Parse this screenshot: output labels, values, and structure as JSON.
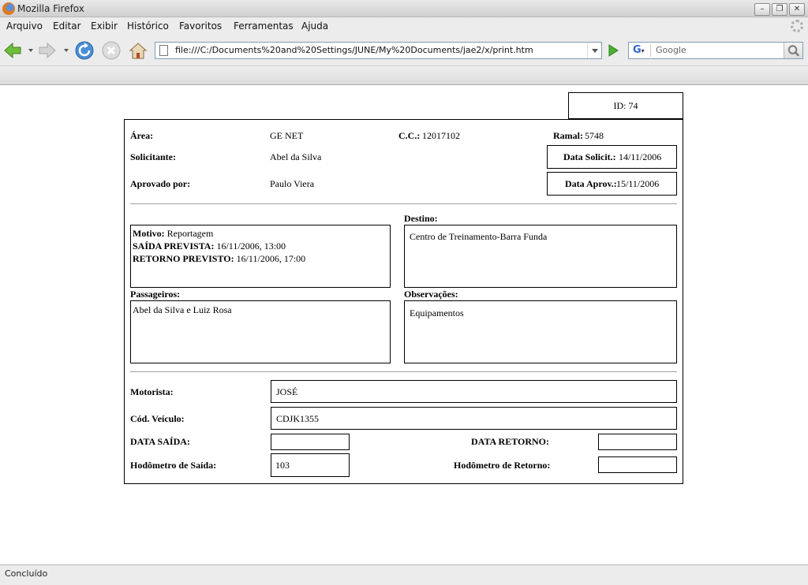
{
  "window": {
    "title": "Mozilla Firefox"
  },
  "menu": [
    "Arquivo",
    "Editar",
    "Exibir",
    "Histórico",
    "Favoritos",
    "Ferramentas",
    "Ajuda"
  ],
  "nav": {
    "url": "file:///C:/Documents%20and%20Settings/JUNE/My%20Documents/jae2/x/print.htm",
    "search_placeholder": "Google"
  },
  "status": "Concluído",
  "form": {
    "id_label": "ID: 74",
    "area_label": "Área:",
    "area_value": "GE NET",
    "cc_label": "C.C.:",
    "cc_value": "12017102",
    "ramal_label": "Ramal:",
    "ramal_value": "5748",
    "solicitante_label": "Solicitante:",
    "solicitante_value": "Abel da Silva",
    "data_solicit_label": "Data Solicit.:",
    "data_solicit_value": "14/11/2006",
    "aprovado_label": "Aprovado por:",
    "aprovado_value": "Paulo Viera",
    "data_aprov_label": "Data Aprov.:",
    "data_aprov_value": "15/11/2006",
    "motivo_label": "Motivo:",
    "motivo_value": "Reportagem",
    "saida_prevista_label": "SAÍDA PREVISTA:",
    "saida_prevista_value": "16/11/2006, 13:00",
    "retorno_previsto_label": "RETORNO PREVISTO:",
    "retorno_previsto_value": "16/11/2006, 17:00",
    "destino_label": "Destino:",
    "destino_value": "Centro de Treinamento-Barra Funda",
    "passageiros_label": "Passageiros:",
    "passageiros_value": "Abel da Silva e Luiz Rosa",
    "observacoes_label": "Observações:",
    "observacoes_value": "Equipamentos",
    "motorista_label": "Motorista:",
    "motorista_value": "JOSÉ",
    "veiculo_label": "Cód. Veículo:",
    "veiculo_value": "CDJK1355",
    "data_saida_label": "DATA SAÍDA:",
    "data_saida_value": "",
    "data_retorno_label": "DATA RETORNO:",
    "data_retorno_value": "",
    "hodometro_saida_label": "Hodômetro de Saída:",
    "hodometro_saida_value": "103",
    "hodometro_retorno_label": "Hodômetro de Retorno:",
    "hodometro_retorno_value": ""
  }
}
